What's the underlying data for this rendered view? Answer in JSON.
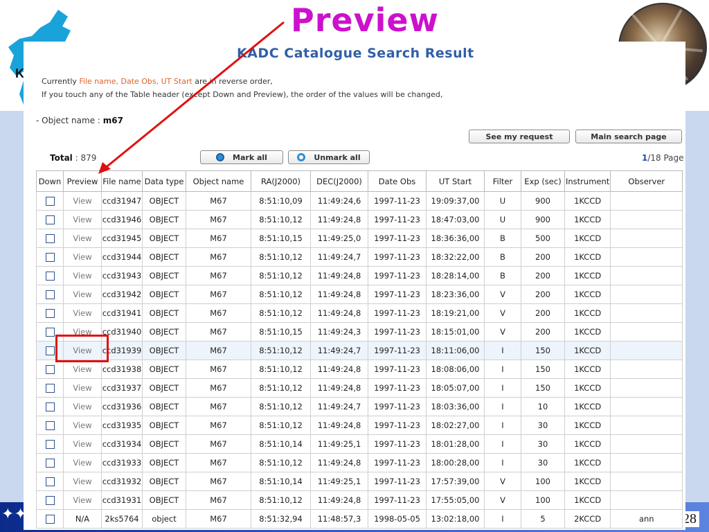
{
  "slide": {
    "title": "Preview",
    "corner_letter": "K",
    "page_number": "28",
    "footer_icon": "star-cluster-icon"
  },
  "app": {
    "title": "KADC Catalogue Search Result",
    "note_line1_prefix": "Currently ",
    "note_line1_highlight": "File name, Date Obs, UT Start",
    "note_line1_suffix": " are in reverse order,",
    "note_line2": "If you touch any of the Table header (except Down and Preview), the order of the values will be changed,",
    "object_label": "- Object name : ",
    "object_value": "m67"
  },
  "buttons": {
    "see_request": "See my request",
    "main_search": "Main search page",
    "mark_all": "Mark all",
    "unmark_all": "Unmark all"
  },
  "summary": {
    "total_label": "Total",
    "total_value": " : 879",
    "page_current": "1",
    "page_rest": "/18 Page"
  },
  "table": {
    "columns": [
      "Down",
      "Preview",
      "File name",
      "Data type",
      "Object name",
      "RA(J2000)",
      "DEC(J2000)",
      "Date Obs",
      "UT Start",
      "Filter",
      "Exp (sec)",
      "Instrument",
      "Observer"
    ],
    "rows": [
      [
        "View",
        "ccd31947",
        "OBJECT",
        "M67",
        "8:51:10,09",
        "11:49:24,6",
        "1997-11-23",
        "19:09:37,00",
        "U",
        "900",
        "1KCCD",
        ""
      ],
      [
        "View",
        "ccd31946",
        "OBJECT",
        "M67",
        "8:51:10,12",
        "11:49:24,8",
        "1997-11-23",
        "18:47:03,00",
        "U",
        "900",
        "1KCCD",
        ""
      ],
      [
        "View",
        "ccd31945",
        "OBJECT",
        "M67",
        "8:51:10,15",
        "11:49:25,0",
        "1997-11-23",
        "18:36:36,00",
        "B",
        "500",
        "1KCCD",
        ""
      ],
      [
        "View",
        "ccd31944",
        "OBJECT",
        "M67",
        "8:51:10,12",
        "11:49:24,7",
        "1997-11-23",
        "18:32:22,00",
        "B",
        "200",
        "1KCCD",
        ""
      ],
      [
        "View",
        "ccd31943",
        "OBJECT",
        "M67",
        "8:51:10,12",
        "11:49:24,8",
        "1997-11-23",
        "18:28:14,00",
        "B",
        "200",
        "1KCCD",
        ""
      ],
      [
        "View",
        "ccd31942",
        "OBJECT",
        "M67",
        "8:51:10,12",
        "11:49:24,8",
        "1997-11-23",
        "18:23:36,00",
        "V",
        "200",
        "1KCCD",
        ""
      ],
      [
        "View",
        "ccd31941",
        "OBJECT",
        "M67",
        "8:51:10,12",
        "11:49:24,8",
        "1997-11-23",
        "18:19:21,00",
        "V",
        "200",
        "1KCCD",
        ""
      ],
      [
        "View",
        "ccd31940",
        "OBJECT",
        "M67",
        "8:51:10,15",
        "11:49:24,3",
        "1997-11-23",
        "18:15:01,00",
        "V",
        "200",
        "1KCCD",
        ""
      ],
      [
        "View",
        "ccd31939",
        "OBJECT",
        "M67",
        "8:51:10,12",
        "11:49:24,7",
        "1997-11-23",
        "18:11:06,00",
        "I",
        "150",
        "1KCCD",
        ""
      ],
      [
        "View",
        "ccd31938",
        "OBJECT",
        "M67",
        "8:51:10,12",
        "11:49:24,8",
        "1997-11-23",
        "18:08:06,00",
        "I",
        "150",
        "1KCCD",
        ""
      ],
      [
        "View",
        "ccd31937",
        "OBJECT",
        "M67",
        "8:51:10,12",
        "11:49:24,8",
        "1997-11-23",
        "18:05:07,00",
        "I",
        "150",
        "1KCCD",
        ""
      ],
      [
        "View",
        "ccd31936",
        "OBJECT",
        "M67",
        "8:51:10,12",
        "11:49:24,7",
        "1997-11-23",
        "18:03:36,00",
        "I",
        "10",
        "1KCCD",
        ""
      ],
      [
        "View",
        "ccd31935",
        "OBJECT",
        "M67",
        "8:51:10,12",
        "11:49:24,8",
        "1997-11-23",
        "18:02:27,00",
        "I",
        "30",
        "1KCCD",
        ""
      ],
      [
        "View",
        "ccd31934",
        "OBJECT",
        "M67",
        "8:51:10,14",
        "11:49:25,1",
        "1997-11-23",
        "18:01:28,00",
        "I",
        "30",
        "1KCCD",
        ""
      ],
      [
        "View",
        "ccd31933",
        "OBJECT",
        "M67",
        "8:51:10,12",
        "11:49:24,8",
        "1997-11-23",
        "18:00:28,00",
        "I",
        "30",
        "1KCCD",
        ""
      ],
      [
        "View",
        "ccd31932",
        "OBJECT",
        "M67",
        "8:51:10,14",
        "11:49:25,1",
        "1997-11-23",
        "17:57:39,00",
        "V",
        "100",
        "1KCCD",
        ""
      ],
      [
        "View",
        "ccd31931",
        "OBJECT",
        "M67",
        "8:51:10,12",
        "11:49:24,8",
        "1997-11-23",
        "17:55:05,00",
        "V",
        "100",
        "1KCCD",
        ""
      ],
      [
        "N/A",
        "2ks5764",
        "object",
        "M67",
        "8:51:32,94",
        "11:48:57,3",
        "1998-05-05",
        "13:02:18,00",
        "I",
        "5",
        "2KCCD",
        "ann"
      ]
    ]
  },
  "colors": {
    "title_magenta": "#cc11cc",
    "app_title_blue": "#2f5fa8",
    "highlight_orange": "#e0602a",
    "annotation_red": "#e01010"
  }
}
